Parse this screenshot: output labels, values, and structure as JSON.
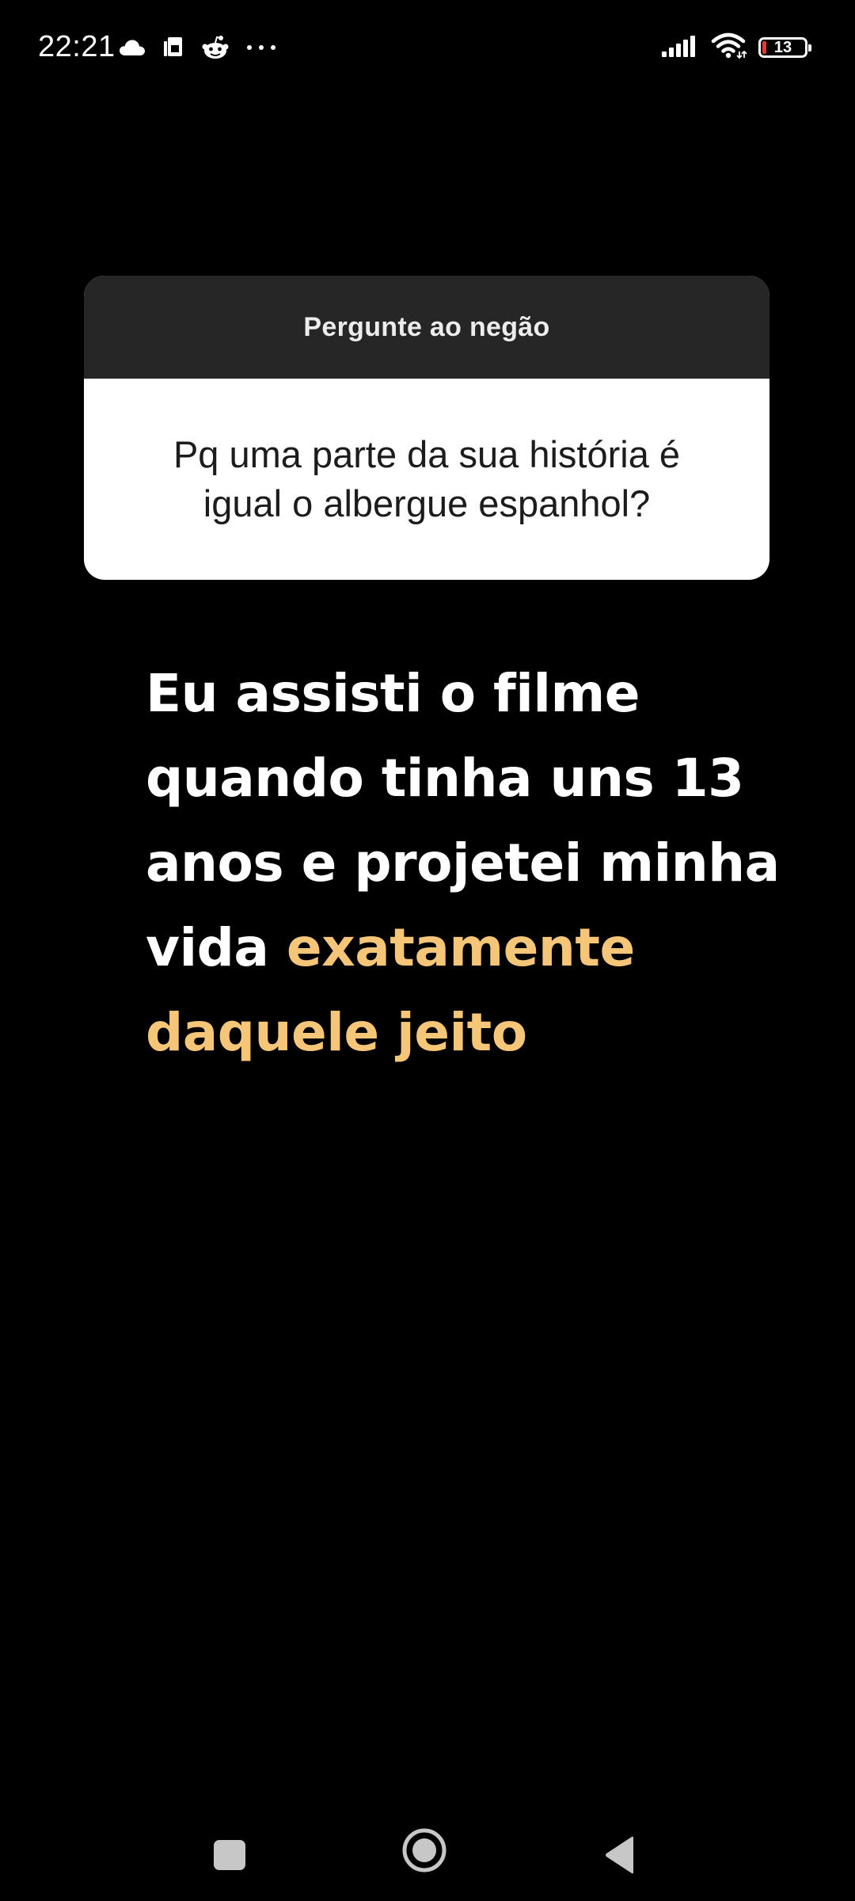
{
  "status_bar": {
    "time": "22:21",
    "left_icons": [
      "cloud-icon",
      "sim-card-icon",
      "reddit-icon",
      "more-notifications-icon"
    ],
    "right_icons": [
      "signal-strength-icon",
      "wifi-icon",
      "battery-icon"
    ],
    "battery_level": "13",
    "battery_low_color": "#e53935"
  },
  "question_card": {
    "header": "Pergunte ao negão",
    "question": "Pq uma parte da sua história é igual o albergue espanhol?",
    "header_bg": "#262626",
    "body_bg": "#ffffff"
  },
  "answer": {
    "plain": "Eu assisti o filme quando tinha uns 13 anos e projetei minha vida",
    "highlight": "exatamente daquele jeito",
    "plain_color": "#ffffff",
    "highlight_color": "#f5c678"
  },
  "nav_bar": {
    "buttons": [
      "recents-square-icon",
      "home-circle-icon",
      "back-triangle-icon"
    ]
  }
}
